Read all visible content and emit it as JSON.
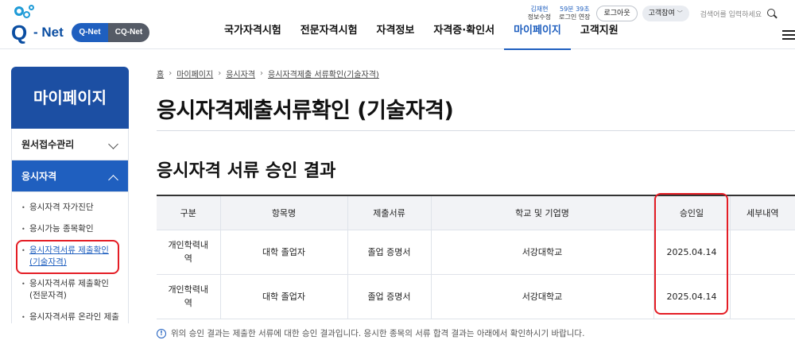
{
  "brand": {
    "logo_text": "Q-Net",
    "pill_a": "Q-Net",
    "pill_b": "CQ-Net"
  },
  "util": {
    "user_name": "김재현",
    "user_edit": "정보수정",
    "timer": "59분 39초",
    "extend": "로그인 연장",
    "logout": "로그아웃",
    "customer": "고객참여",
    "search_placeholder": "검색어를 입력하세요"
  },
  "gnb": [
    "국가자격시험",
    "전문자격시험",
    "자격정보",
    "자격증·확인서",
    "마이페이지",
    "고객지원"
  ],
  "sidebar": {
    "title": "마이페이지",
    "menu": [
      "원서접수관리",
      "응시자격"
    ],
    "sub_items": [
      "응시자격 자가진단",
      "응시가능 종목확인",
      "응시자격서류 제출확인",
      "(기술자격)",
      "응시자격서류 제출확인",
      "(전문자격)",
      "응시자격서류 온라인 제출"
    ]
  },
  "breadcrumb": [
    "홈",
    "마이페이지",
    "응시자격",
    "응시자격제출 서류확인(기술자격)"
  ],
  "page_title": "응시자격제출서류확인 (기술자격)",
  "section_title": "응시자격 서류 승인 결과",
  "table": {
    "headers": [
      "구분",
      "항목명",
      "제출서류",
      "학교 및 기업명",
      "승인일",
      "세부내역"
    ],
    "rows": [
      {
        "category_1": "개인학력내",
        "category_2": "역",
        "item": "대학 졸업자",
        "doc": "졸업 증명서",
        "org": "서강대학교",
        "date": "2025.04.14",
        "detail": ""
      },
      {
        "category_1": "개인학력내",
        "category_2": "역",
        "item": "대학 졸업자",
        "doc": "졸업 증명서",
        "org": "서강대학교",
        "date": "2025.04.14",
        "detail": ""
      }
    ]
  },
  "note": "위의 승인 결과는 제출한 서류에 대한 승인 결과입니다. 응시한 종목의 서류 합격 결과는 아래에서 확인하시기 바랍니다.",
  "info_glyph": "!"
}
